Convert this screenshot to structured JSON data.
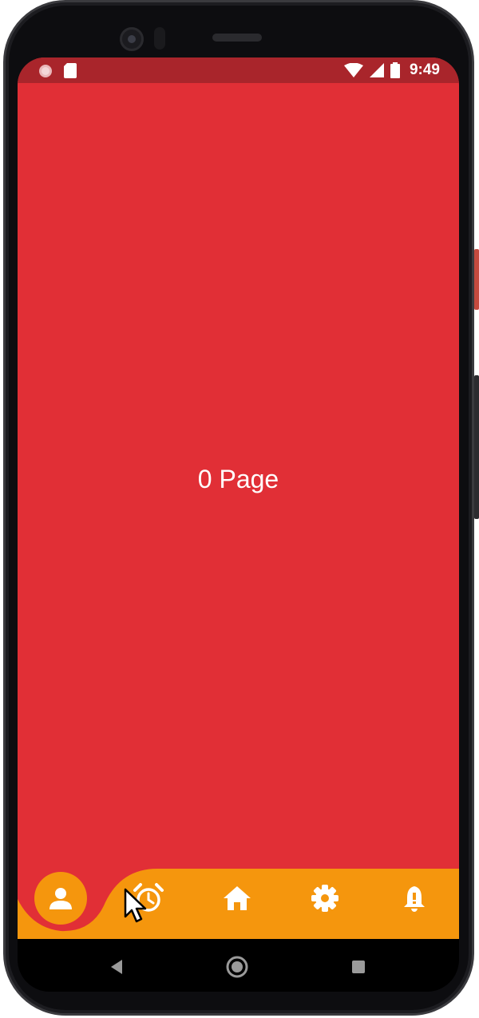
{
  "status_bar": {
    "time": "9:49",
    "icons": [
      "notification-dot-icon",
      "sim-card-icon",
      "wifi-icon",
      "signal-icon",
      "battery-icon"
    ]
  },
  "page": {
    "label": "0 Page"
  },
  "bottom_nav": {
    "items": [
      {
        "icon": "person-icon",
        "active": true
      },
      {
        "icon": "alarm-icon",
        "active": false
      },
      {
        "icon": "home-icon",
        "active": false
      },
      {
        "icon": "settings-icon",
        "active": false
      },
      {
        "icon": "notification-bell-icon",
        "active": false
      }
    ]
  },
  "system_nav": {
    "buttons": [
      "back-icon",
      "home-circle-icon",
      "recents-icon"
    ]
  },
  "colors": {
    "page_background": "#e12f36",
    "status_bar": "#a9252b",
    "nav_bar": "#f5960d",
    "icon": "#ffffff"
  }
}
